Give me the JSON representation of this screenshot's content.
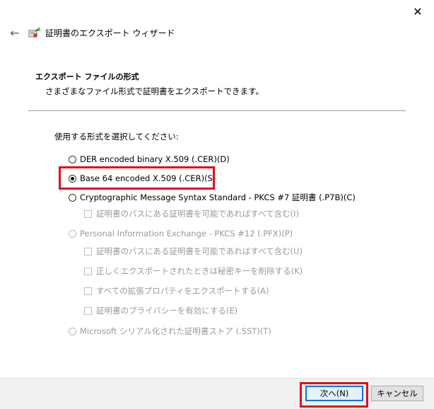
{
  "window": {
    "close_glyph": "✕",
    "back_glyph": "←",
    "title": "証明書のエクスポート ウィザード",
    "title_icon": "certificate-export-wizard-icon"
  },
  "header": {
    "heading": "エクスポート ファイルの形式",
    "description": "さまざまなファイル形式で証明書をエクスポートできます。"
  },
  "content": {
    "prompt": "使用する形式を選択してください:",
    "options": {
      "der": "DER encoded binary X.509 (.CER)(D)",
      "base64": "Base 64 encoded X.509 (.CER)(S)",
      "pkcs7": "Cryptographic Message Syntax Standard - PKCS #7 証明書 (.P7B)(C)",
      "pkcs7_include_path": "証明書のパスにある証明書を可能であればすべて含む(I)",
      "pfx": "Personal Information Exchange - PKCS #12 (.PFX)(P)",
      "pfx_include_path": "証明書のパスにある証明書を可能であればすべて含む(U)",
      "pfx_delete_key": "正しくエクスポートされたときは秘密キーを削除する(K)",
      "pfx_export_ext_props": "すべての拡張プロパティをエクスポートする(A)",
      "pfx_enable_privacy": "証明書のプライバシーを有効にする(E)",
      "sst": "Microsoft シリアル化された証明書ストア (.SST)(T)"
    },
    "selected_option": "base64"
  },
  "footer": {
    "next_label": "次へ(N)",
    "cancel_label": "キャンセル"
  },
  "colors": {
    "highlight": "#e0101e",
    "primary_button_border": "#0078d7",
    "disabled_text": "#9a9a9a"
  }
}
